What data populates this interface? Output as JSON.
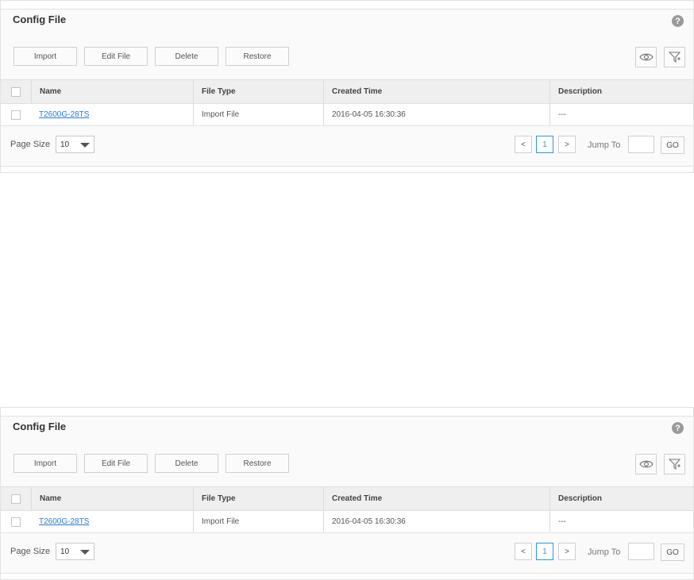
{
  "panel": {
    "title": "Config File",
    "help_icon_text": "?",
    "buttons": {
      "import": "Import",
      "edit_file": "Edit File",
      "delete": "Delete",
      "restore": "Restore"
    },
    "table": {
      "headers": [
        "Name",
        "File Type",
        "Created Time",
        "Description"
      ],
      "rows": [
        {
          "name": "T2600G-28TS",
          "file_type": "Import File",
          "created_time": "2016-04-05 16:30:36",
          "description": "---"
        }
      ]
    },
    "pagination": {
      "page_size_label": "Page Size",
      "page_size_value": "10",
      "prev": "<",
      "current_page": "1",
      "next": ">",
      "jump_label": "Jump To",
      "go_label": "GO"
    }
  },
  "icons": {
    "help": "help-icon",
    "view": "eye-icon",
    "filter": "filter-icon"
  },
  "colors": {
    "link": "#2a7ad1",
    "active_page": "#2f96d6"
  }
}
